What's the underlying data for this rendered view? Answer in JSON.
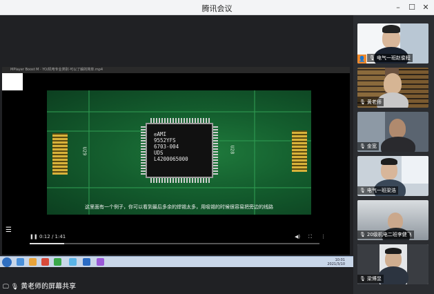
{
  "window": {
    "title": "腾讯会议",
    "minimize": "–",
    "maximize": "☐",
    "close": "✕"
  },
  "player": {
    "title_text": "MPlayer Boost M · YO/机电专业类别·可以了解的简单.mp4",
    "chip_text": "◎AMI\n9552YFS\n6703-004\nUDS\nL4200065000",
    "label_left": "U29",
    "label_right": "U28",
    "subtitle": "这里面有一个例子，你可以看到最后多余的焊锡太多，用吸锡的时候很容易把旁边的线路",
    "time": "0:12 / 1:41",
    "progress": 0.12
  },
  "taskbar": {
    "tray_time": "10:01",
    "tray_date": "2021/3/10"
  },
  "share": {
    "label": "黄老师的屏幕共享"
  },
  "participants": [
    {
      "name": "电气一班赵俊程"
    },
    {
      "name": "黄老师"
    },
    {
      "name": "金宽"
    },
    {
      "name": "电气一班梁浩"
    },
    {
      "name": "20级机电二班李健飞"
    },
    {
      "name": "梁博昱"
    }
  ],
  "colors": {
    "titlebar_bg": "#f3f4f6",
    "sidebar_bg": "#2b2d31",
    "pcb_green": "#1f7a3c",
    "avatar_orange": "#f08a2c"
  }
}
